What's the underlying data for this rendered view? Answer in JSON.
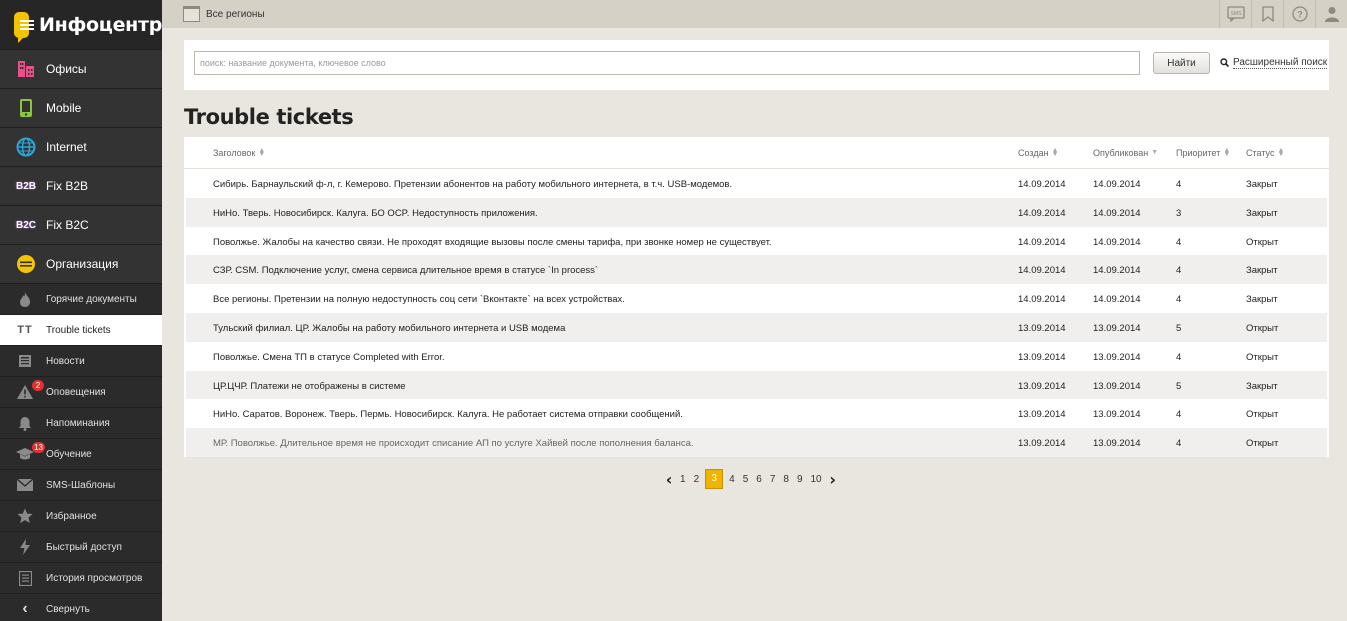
{
  "app": {
    "title": "Инфоцентр"
  },
  "topbar": {
    "region": "Все регионы"
  },
  "sidebar": {
    "main": [
      {
        "label": "Офисы",
        "icon": "building-icon",
        "color": "#e8508a"
      },
      {
        "label": "Mobile",
        "icon": "mobile-icon",
        "color": "#8cc63f"
      },
      {
        "label": "Internet",
        "icon": "globe-icon",
        "color": "#2aa6d8"
      },
      {
        "label": "Fix B2B",
        "icon": "b2b-icon",
        "icon_text": "B2B",
        "color": "#9b59b6"
      },
      {
        "label": "Fix B2C",
        "icon": "b2c-icon",
        "icon_text": "B2C",
        "color": "#9b59b6"
      },
      {
        "label": "Организация",
        "icon": "organization-icon",
        "color": "#f5c400"
      }
    ],
    "secondary": [
      {
        "label": "Горячие документы",
        "icon": "fire-icon"
      },
      {
        "label": "Trouble tickets",
        "icon": "tt-icon",
        "icon_text": "TT",
        "active": true
      },
      {
        "label": "Новости",
        "icon": "news-icon"
      },
      {
        "label": "Оповещения",
        "icon": "alert-icon",
        "badge": "2"
      },
      {
        "label": "Напоминания",
        "icon": "bell-icon"
      },
      {
        "label": "Обучение",
        "icon": "education-icon",
        "badge": "13"
      },
      {
        "label": "SMS-Шаблоны",
        "icon": "envelope-icon"
      },
      {
        "label": "Избранное",
        "icon": "star-icon"
      },
      {
        "label": "Быстрый доступ",
        "icon": "lightning-icon"
      },
      {
        "label": "История просмотров",
        "icon": "history-icon"
      },
      {
        "label": "Свернуть",
        "icon": "collapse-icon"
      }
    ]
  },
  "search": {
    "placeholder": "поиск: название документа, ключевое слово",
    "button": "Найти",
    "advanced": "Расширенный поиск"
  },
  "page_title": "Trouble tickets",
  "table": {
    "headers": {
      "title": "Заголовок",
      "created": "Создан",
      "published": "Опубликован",
      "priority": "Приоритет",
      "status": "Статус"
    },
    "rows": [
      {
        "title": "Сибирь. Барнаульский ф-л, г. Кемерово. Претензии абонентов на работу мобильного интернета, в т.ч. USB-модемов.",
        "created": "14.09.2014",
        "published": "14.09.2014",
        "priority": "4",
        "status": "Закрыт"
      },
      {
        "title": "НиНо. Тверь. Новосибирск. Калуга. БО OCP. Недоступность приложения.",
        "created": "14.09.2014",
        "published": "14.09.2014",
        "priority": "3",
        "status": "Закрыт"
      },
      {
        "title": "Поволжье. Жалобы на качество связи. Не проходят входящие вызовы после смены тарифа, при звонке номер не существует.",
        "created": "14.09.2014",
        "published": "14.09.2014",
        "priority": "4",
        "status": "Открыт"
      },
      {
        "title": "СЗР. CSM. Подключение услуг, смена сервиса длительное время в статусе `In process`",
        "created": "14.09.2014",
        "published": "14.09.2014",
        "priority": "4",
        "status": "Закрыт"
      },
      {
        "title": "Все регионы. Претензии на полную недоступность соц сети `Вконтакте` на всех устройствах.",
        "created": "14.09.2014",
        "published": "14.09.2014",
        "priority": "4",
        "status": "Закрыт"
      },
      {
        "title": "Тульский филиал. ЦР. Жалобы на работу мобильного интернета и USB модема",
        "created": "13.09.2014",
        "published": "13.09.2014",
        "priority": "5",
        "status": "Открыт"
      },
      {
        "title": "Поволжье. Смена ТП в статусе Completed with Error.",
        "created": "13.09.2014",
        "published": "13.09.2014",
        "priority": "4",
        "status": "Открыт"
      },
      {
        "title": "ЦР.ЦЧР. Платежи не отображены в системе",
        "created": "13.09.2014",
        "published": "13.09.2014",
        "priority": "5",
        "status": "Закрыт"
      },
      {
        "title": "НиНо. Саратов. Воронеж. Тверь. Пермь. Новосибирск. Калуга. Не работает система отправки сообщений.",
        "created": "13.09.2014",
        "published": "13.09.2014",
        "priority": "4",
        "status": "Открыт"
      },
      {
        "title": "МР. Поволжье. Длительное время не происходит списание АП по услуге Хайвей после пополнения баланса.",
        "created": "13.09.2014",
        "published": "13.09.2014",
        "priority": "4",
        "status": "Открыт"
      }
    ]
  },
  "pagination": {
    "pages": [
      "1",
      "2",
      "3",
      "4",
      "5",
      "6",
      "7",
      "8",
      "9",
      "10"
    ],
    "current": "3"
  }
}
